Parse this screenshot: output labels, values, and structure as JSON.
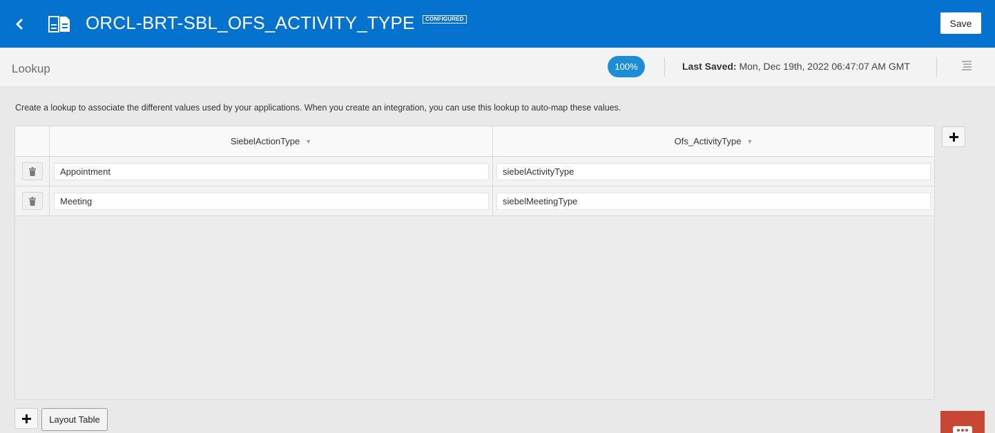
{
  "header": {
    "back_icon": "chevron-left-icon",
    "doc_icon": "lookup-document-icon",
    "title": "ORCL-BRT-SBL_OFS_ACTIVITY_TYPE",
    "badge": "CONFIGURED",
    "save_label": "Save",
    "color": "#0572ce"
  },
  "subheader": {
    "page_label": "Lookup",
    "progress": "100%",
    "last_saved_label": "Last Saved:",
    "last_saved_value": "Mon, Dec 19th, 2022 06:47:07 AM GMT",
    "menu_icon": "hamburger-menu-icon"
  },
  "description": "Create a lookup to associate the different values used by your applications. When you create an integration, you can use this lookup to auto-map these values.",
  "table": {
    "columns": [
      {
        "label": "SiebelActionType"
      },
      {
        "label": "Ofs_ActivityType"
      }
    ],
    "rows": [
      {
        "values": [
          "Appointment",
          "siebelActivityType"
        ]
      },
      {
        "values": [
          "Meeting",
          "siebelMeetingType"
        ]
      }
    ],
    "row_delete_icon": "trash-icon",
    "add_column_icon": "plus-icon"
  },
  "footer": {
    "add_row_icon": "plus-icon",
    "layout_label": "Layout Table"
  },
  "chat": {
    "icon": "chat-bubble-icon",
    "color": "#c74634"
  }
}
